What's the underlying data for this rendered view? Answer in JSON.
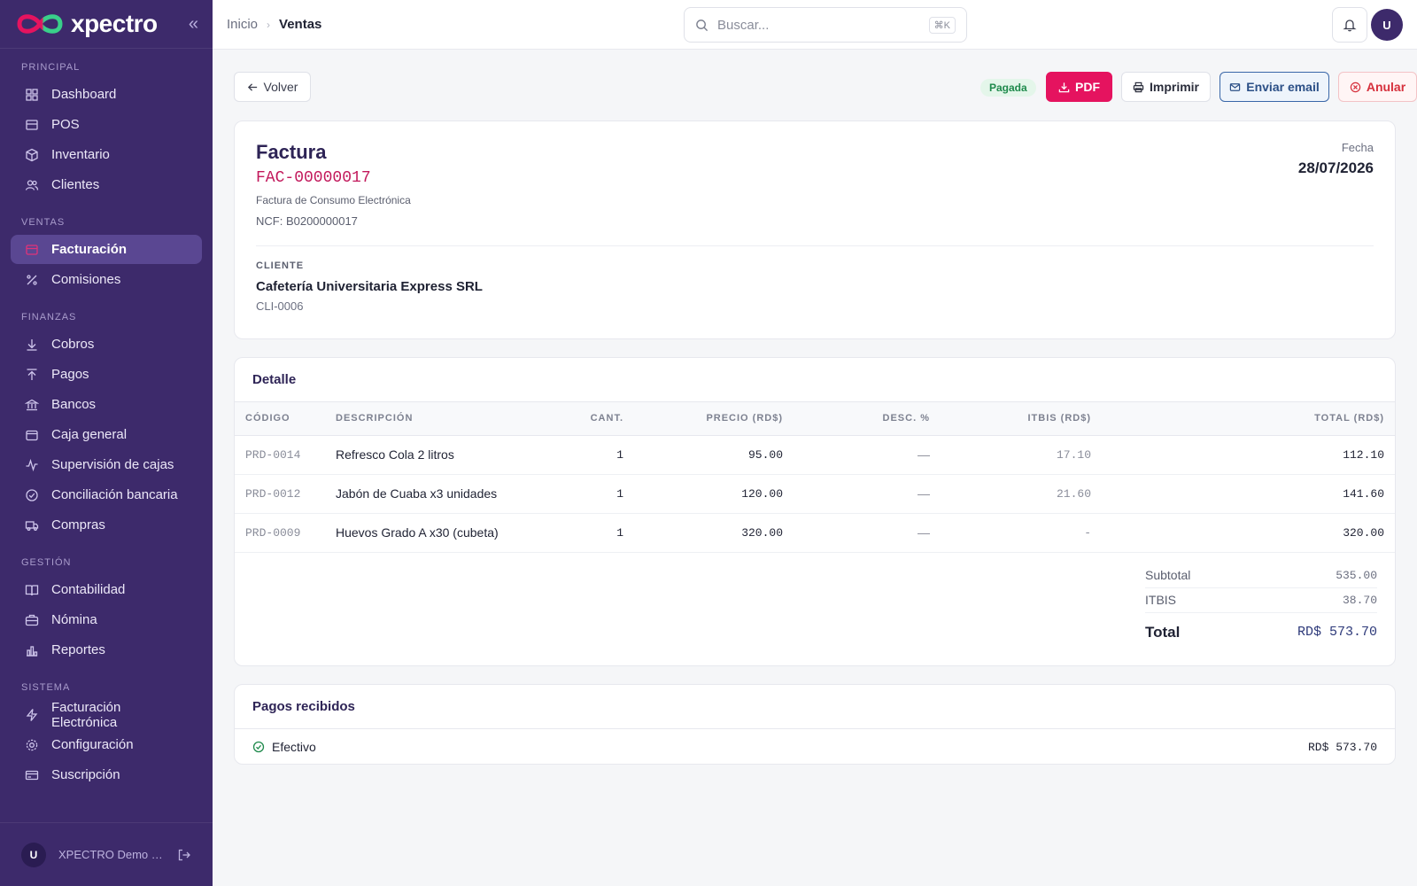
{
  "brand": {
    "name": "xpectro"
  },
  "sidebar": {
    "sections": [
      {
        "title": "PRINCIPAL",
        "items": [
          {
            "label": "Dashboard",
            "icon": "grid-icon"
          },
          {
            "label": "POS",
            "icon": "store-icon"
          },
          {
            "label": "Inventario",
            "icon": "box-icon"
          },
          {
            "label": "Clientes",
            "icon": "users-icon"
          }
        ]
      },
      {
        "title": "VENTAS",
        "items": [
          {
            "label": "Facturación",
            "icon": "invoice-icon",
            "active": true
          },
          {
            "label": "Comisiones",
            "icon": "percent-icon"
          }
        ]
      },
      {
        "title": "FINANZAS",
        "items": [
          {
            "label": "Cobros",
            "icon": "arrow-down-icon"
          },
          {
            "label": "Pagos",
            "icon": "arrow-up-icon"
          },
          {
            "label": "Bancos",
            "icon": "bank-icon"
          },
          {
            "label": "Caja general",
            "icon": "wallet-icon"
          },
          {
            "label": "Supervisión de cajas",
            "icon": "activity-icon"
          },
          {
            "label": "Conciliación bancaria",
            "icon": "check-circle-icon"
          },
          {
            "label": "Compras",
            "icon": "truck-icon"
          }
        ]
      },
      {
        "title": "GESTIÓN",
        "items": [
          {
            "label": "Contabilidad",
            "icon": "book-icon"
          },
          {
            "label": "Nómina",
            "icon": "briefcase-icon"
          },
          {
            "label": "Reportes",
            "icon": "bar-chart-icon"
          }
        ]
      },
      {
        "title": "SISTEMA",
        "items": [
          {
            "label": "Facturación Electrónica",
            "icon": "zap-icon"
          },
          {
            "label": "Configuración",
            "icon": "gear-icon"
          },
          {
            "label": "Suscripción",
            "icon": "credit-card-icon"
          }
        ]
      }
    ],
    "footer": {
      "avatar": "U",
      "name": "XPECTRO Demo S..."
    }
  },
  "topbar": {
    "breadcrumb_home": "Inicio",
    "breadcrumb_current": "Ventas",
    "search_placeholder": "Buscar...",
    "search_shortcut": "⌘K",
    "avatar": "U"
  },
  "actions": {
    "back": "Volver",
    "status": "Pagada",
    "pdf": "PDF",
    "print": "Imprimir",
    "email": "Enviar email",
    "void": "Anular"
  },
  "invoice": {
    "title": "Factura",
    "number": "FAC-00000017",
    "type": "Factura de Consumo Electrónica",
    "ncf": "NCF: B0200000017",
    "date_label": "Fecha",
    "date": "28/07/2026",
    "client_label": "CLIENTE",
    "client_name": "Cafetería Universitaria Express SRL",
    "client_code": "CLI-0006"
  },
  "detail": {
    "title": "Detalle",
    "columns": [
      "CÓDIGO",
      "DESCRIPCIÓN",
      "CANT.",
      "PRECIO (RD$)",
      "DESC. %",
      "ITBIS (RD$)",
      "TOTAL (RD$)"
    ],
    "rows": [
      [
        "PRD-0014",
        "Refresco Cola 2 litros",
        "1",
        "95.00",
        "—",
        "17.10",
        "112.10"
      ],
      [
        "PRD-0012",
        "Jabón de Cuaba x3 unidades",
        "1",
        "120.00",
        "—",
        "21.60",
        "141.60"
      ],
      [
        "PRD-0009",
        "Huevos Grado A x30 (cubeta)",
        "1",
        "320.00",
        "—",
        "-",
        "320.00"
      ]
    ],
    "subtotal_label": "Subtotal",
    "subtotal": "535.00",
    "itbis_label": "ITBIS",
    "itbis": "38.70",
    "total_label": "Total",
    "total": "RD$ 573.70"
  },
  "payments": {
    "title": "Pagos recibidos",
    "items": [
      {
        "method": "Efectivo",
        "amount": "RD$ 573.70"
      }
    ]
  },
  "colors": {
    "sidebar": "#3d2a6b",
    "accent": "#e5135f",
    "success": "#1f8a4c"
  }
}
